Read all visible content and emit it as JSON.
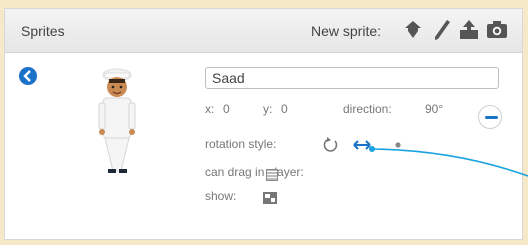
{
  "header": {
    "title": "Sprites",
    "new_sprite_label": "New sprite:"
  },
  "sprite": {
    "name": "Saad",
    "x_label": "x:",
    "x_value": "0",
    "y_label": "y:",
    "y_value": "0",
    "direction_label": "direction:",
    "direction_value": "90°",
    "rotation_style_label": "rotation style:",
    "can_drag_label": "can drag in player:",
    "show_label": "show:"
  },
  "colors": {
    "accent": "#1a73c9",
    "callout_line": "#1aa3e0"
  }
}
